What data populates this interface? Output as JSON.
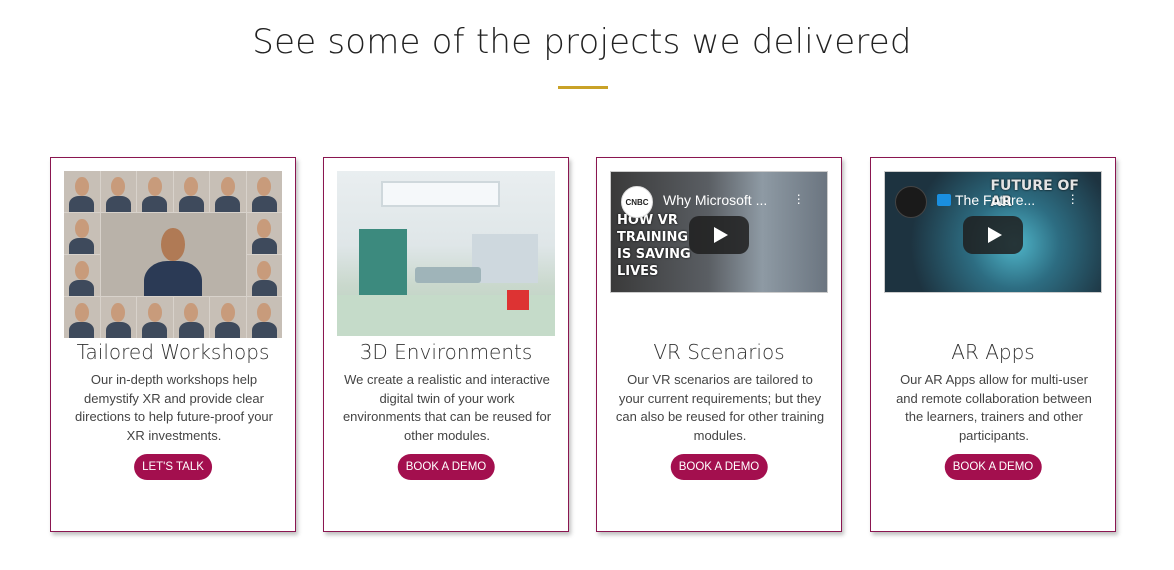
{
  "section": {
    "heading": "See some of the projects we delivered",
    "accent_color": "#c9a227"
  },
  "cards": [
    {
      "title": "Tailored Workshops",
      "description": "Our in-depth workshops help demystify XR and provide clear directions to help future-proof your XR investments.",
      "button": "LET'S TALK",
      "media": "video-call-collage-image"
    },
    {
      "title": "3D Environments",
      "description": "We create a realistic and interactive digital twin of your work environments that can be reused for other modules.",
      "button": "BOOK A DEMO",
      "media": "operating-room-render-image"
    },
    {
      "title": "VR Scenarios",
      "description": "Our VR scenarios are tailored to your current requirements; but they can also be reused for other training modules.",
      "button": "BOOK A DEMO",
      "video": {
        "title": "Why Microsoft ...",
        "channel": "CNBC",
        "overlay": "HOW VR\nTRAINING\nIS SAVING\nLIVES"
      }
    },
    {
      "title": "AR Apps",
      "description": "Our AR Apps allow for multi-user and remote collaboration between the learners, trainers and other participants.",
      "button": "BOOK A DEMO",
      "video": {
        "title": "The Future...",
        "overlay": "FUTURE OF\nAR"
      }
    }
  ],
  "colors": {
    "card_border": "#8a1650",
    "button_bg": "#a30f4e",
    "button_text": "#ffffff"
  }
}
